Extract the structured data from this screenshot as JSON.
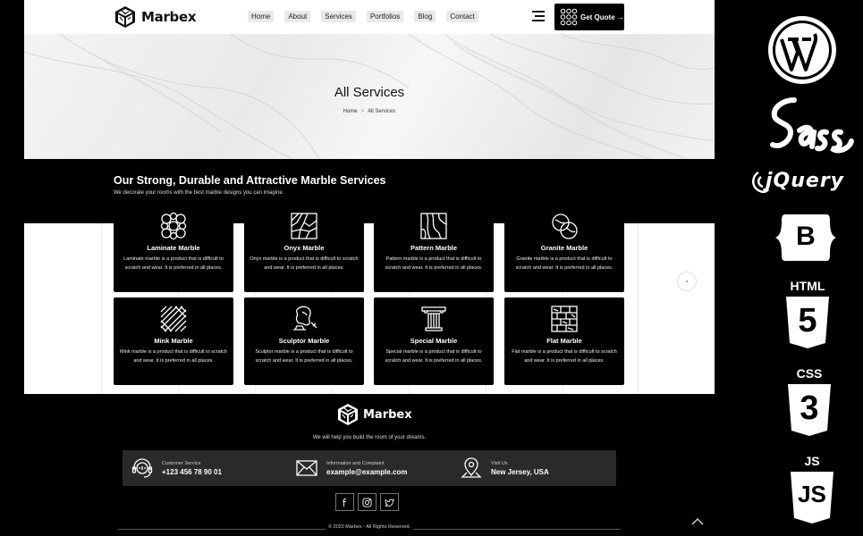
{
  "brand": {
    "name": "Marbex"
  },
  "nav": {
    "items": [
      "Home",
      "About",
      "Services",
      "Portfolios",
      "Blog",
      "Contact"
    ],
    "cta": "Get Quote →"
  },
  "hero": {
    "title": "All Services",
    "breadcrumb": [
      "Home",
      "All Services"
    ],
    "breadcrumb_sep": ">"
  },
  "services": {
    "title": "Our Strong, Durable and Attractive Marble Services",
    "subtitle": "We decorate your rooms with the best marble designs you can imagine.",
    "cards": [
      {
        "icon": "laminate-marble-icon",
        "title": "Laminate Marble",
        "desc": "Laminate marble is a product that is difficult to scratch and wear. It is preferred in all places."
      },
      {
        "icon": "onyx-marble-icon",
        "title": "Onyx Marble",
        "desc": "Onyx marble is a product that is difficult to scratch and wear. It is preferred in all places."
      },
      {
        "icon": "pattern-marble-icon",
        "title": "Pattern Marble",
        "desc": "Pattern marble is a product that is difficult to scratch and wear. It is preferred in all places."
      },
      {
        "icon": "granite-marble-icon",
        "title": "Granite Marble",
        "desc": "Granite marble is a product that is difficult to scratch and wear. It is preferred in all places."
      },
      {
        "icon": "mink-marble-icon",
        "title": "Mink Marble",
        "desc": "Mink marble is a product that is difficult to scratch and wear. It is preferred in all places."
      },
      {
        "icon": "sculptor-marble-icon",
        "title": "Sculptor Marble",
        "desc": "Sculptor marble is a product that is difficult to scratch and wear. It is preferred in all places."
      },
      {
        "icon": "special-marble-icon",
        "title": "Special Marble",
        "desc": "Special marble is a product that is difficult to scratch and wear. It is preferred in all places."
      },
      {
        "icon": "flat-marble-icon",
        "title": "Flat Marble",
        "desc": "Flat marble is a product that is difficult to scratch and wear. It is preferred in all places."
      }
    ]
  },
  "footer": {
    "tagline": "We will help you build the room of your dreams.",
    "contacts": [
      {
        "icon": "headset-icon",
        "label": "Customer Service",
        "value": "+123 456 78 90 01"
      },
      {
        "icon": "mail-icon",
        "label": "Information and Complaint",
        "value": "example@example.com"
      },
      {
        "icon": "map-pin-icon",
        "label": "Visit Us",
        "value": "New Jersey, USA"
      }
    ],
    "socials": [
      "facebook-icon",
      "instagram-icon",
      "twitter-icon"
    ],
    "copyright": "© 2022 Marbex - All Rights Reserved."
  },
  "tech_stack": [
    {
      "icon": "wordpress-icon"
    },
    {
      "icon": "sass-icon",
      "label": "Sass"
    },
    {
      "icon": "jquery-icon",
      "label": "jQuery"
    },
    {
      "icon": "bootstrap-icon",
      "label": "B"
    },
    {
      "icon": "html5-icon",
      "label": "HTML",
      "digit": "5"
    },
    {
      "icon": "css3-icon",
      "label": "CSS",
      "digit": "3"
    },
    {
      "icon": "js-icon",
      "label": "JS",
      "digit": "JS"
    }
  ],
  "colors": {
    "black": "#000000",
    "white": "#ffffff",
    "contact_bar": "#2a2a2a"
  }
}
